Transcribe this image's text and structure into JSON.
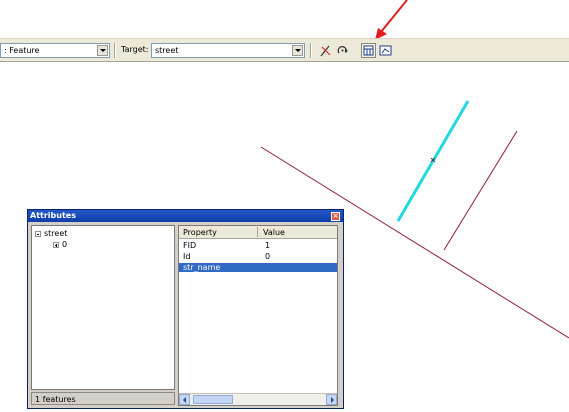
{
  "toolbar": {
    "task_value": ": Feature",
    "target_label": "Target:",
    "target_value": "street",
    "icons": [
      "sketch-tool-icon",
      "rotate-tool-icon",
      "attributes-icon",
      "sketch-properties-icon"
    ]
  },
  "annotation": {
    "arrow_color": "#e02020"
  },
  "map": {
    "street_color": "#8b1a3a",
    "selected_feature_color": "#22d8e0"
  },
  "attributes_window": {
    "title": "Attributes",
    "close_glyph": "×",
    "tree": [
      {
        "label": "street",
        "expander": "−"
      },
      {
        "label": "0",
        "expander": "+"
      }
    ],
    "status": "1 features",
    "columns": {
      "property": "Property",
      "value": "Value"
    },
    "rows": [
      {
        "property": "FID",
        "value": "1",
        "selected": false
      },
      {
        "property": "Id",
        "value": "0",
        "selected": false
      },
      {
        "property": "str_name",
        "value": "",
        "selected": true
      }
    ]
  }
}
